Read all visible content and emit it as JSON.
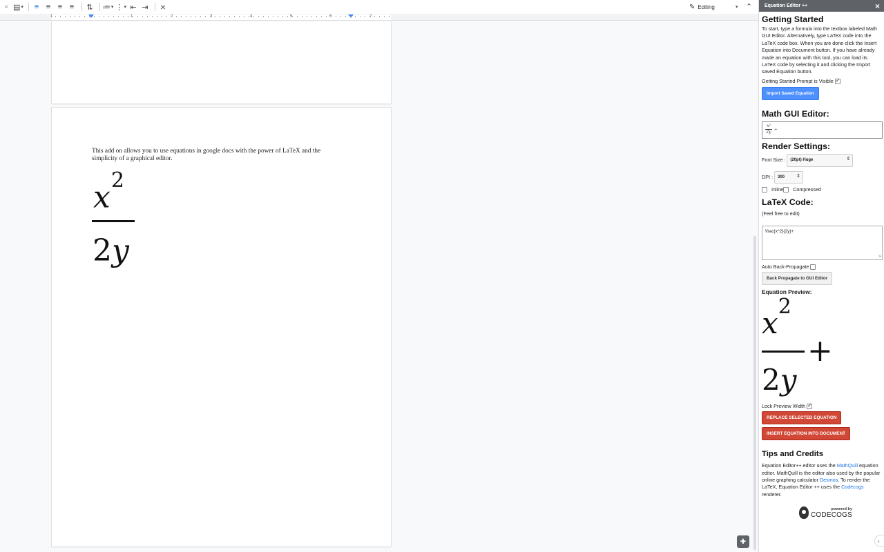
{
  "toolbar": {
    "mode_label": "Editing",
    "ruler_numbers": [
      "1",
      "1",
      "2",
      "3",
      "4",
      "5",
      "6",
      "7"
    ]
  },
  "document": {
    "body_text": "This add on allows you to use equations in google docs with the power of LaTeX and the simplicity of a graphical editor.",
    "equation": {
      "numerator": "x",
      "exponent": "2",
      "denominator_coef": "2",
      "denominator_var": "y"
    }
  },
  "sidebar": {
    "title": "Equation Editor ++",
    "getting_started": {
      "heading": "Getting Started",
      "text": "To start, type a formula into the textbox labeled Math GUI Editor. Alternatively, type LaTeX code into the LaTeX code box. When you are done click the Insert Equation into Document button. If you have already made an equation with this tool, you can load its LaTeX code by selecting it and clicking the Import saved Equation button.",
      "prompt_visible_label": "Getting Started Prompt is Visible",
      "prompt_visible_checked": true,
      "import_button": "Import Saved Equation"
    },
    "math_gui": {
      "heading": "Math GUI Editor:",
      "frac_num": "x²",
      "frac_den": "2y",
      "trailing": "+"
    },
    "render_settings": {
      "heading": "Render Settings:",
      "font_size_label": "Font Size :",
      "font_size_value": "(20pt) Huge",
      "dpi_label": "DPI :",
      "dpi_value": "300",
      "inline_label": "Inline",
      "compressed_label": "Compressed"
    },
    "latex": {
      "heading": "LaTeX Code:",
      "hint": "(Feel free to edit)",
      "code": "\\frac{x^2}{2y}+",
      "auto_back_label": "Auto Back-Propagate",
      "back_button": "Back Propagate to GUI Editor"
    },
    "preview": {
      "heading": "Equation Preview:",
      "numerator": "x",
      "exponent": "2",
      "denominator_coef": "2",
      "denominator_var": "y",
      "plus": "+",
      "lock_label": "Lock Preview Width",
      "lock_checked": true
    },
    "actions": {
      "replace_button": "REPLACE SELECTED EQUATION",
      "insert_button": "INSERT EQUATION INTO DOCUMENT"
    },
    "tips": {
      "heading": "Tips and Credits",
      "t1": "Equation Editor++ editor uses the ",
      "link_mathquill": "MathQuill",
      "t2": " equation editor. MathQuill is the editor also used by the popular online graphing calculator ",
      "link_desmos": "Desmos",
      "t3": ". To render the LaTeX, Equation Editor ++ uses the ",
      "link_codecogs": "Codecogs",
      "t4": " renderer.",
      "logo_powered": "powered by",
      "logo_name": "CODECOGS"
    }
  }
}
